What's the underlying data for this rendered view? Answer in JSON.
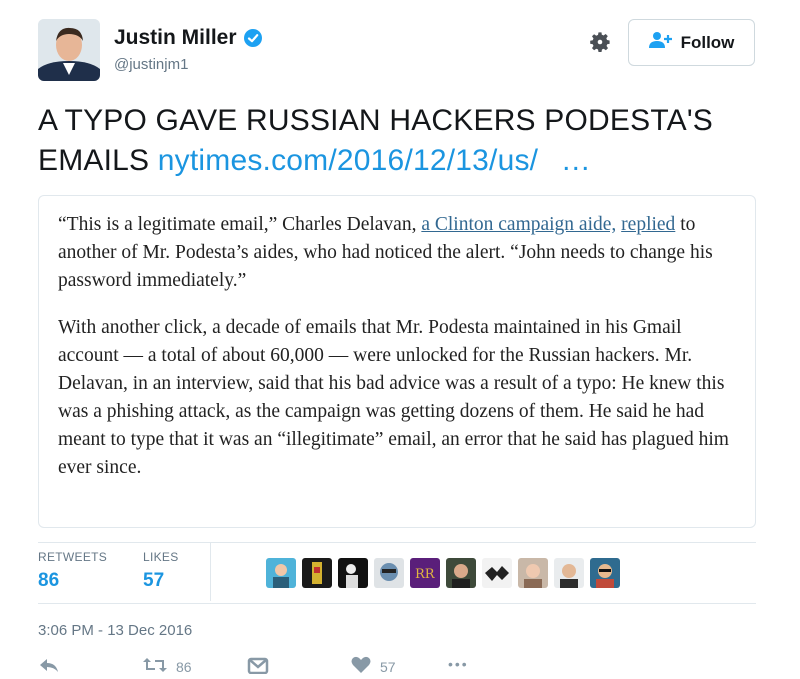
{
  "user": {
    "name": "Justin Miller",
    "handle": "@justinjm1"
  },
  "follow_button": {
    "label": "Follow"
  },
  "tweet": {
    "text": "A TYPO GAVE RUSSIAN HACKERS PODESTA'S EMAILS",
    "link": "nytimes.com/2016/12/13/us/",
    "ellipsis": "…"
  },
  "quote": {
    "p1_a": "“This is a legitimate email,” Charles Delavan, ",
    "p1_link1": "a Clinton campaign aide,",
    "p1_link2": "replied",
    "p1_b": " to another of Mr. Podesta’s aides, who had noticed the alert. “John needs to change his password immediately.”",
    "p2": "With another click, a decade of emails that Mr. Podesta maintained in his Gmail account — a total of about 60,000 — were unlocked for the Russian hackers. Mr. Delavan, in an interview, said that his bad advice was a result of a typo: He knew this was a phishing attack, as the campaign was getting dozens of them. He said he had meant to type that it was an “illegitimate” email, an error that he said has plagued him ever since."
  },
  "stats": {
    "retweets_label": "RETWEETS",
    "retweets": "86",
    "likes_label": "LIKES",
    "likes": "57"
  },
  "timestamp": "3:06 PM - 13 Dec 2016",
  "actions": {
    "retweet_count": "86",
    "like_count": "57",
    "more": "•••"
  },
  "colors": {
    "accent": "#1b95e0",
    "muted": "#657786",
    "nyt_link": "#326891"
  }
}
